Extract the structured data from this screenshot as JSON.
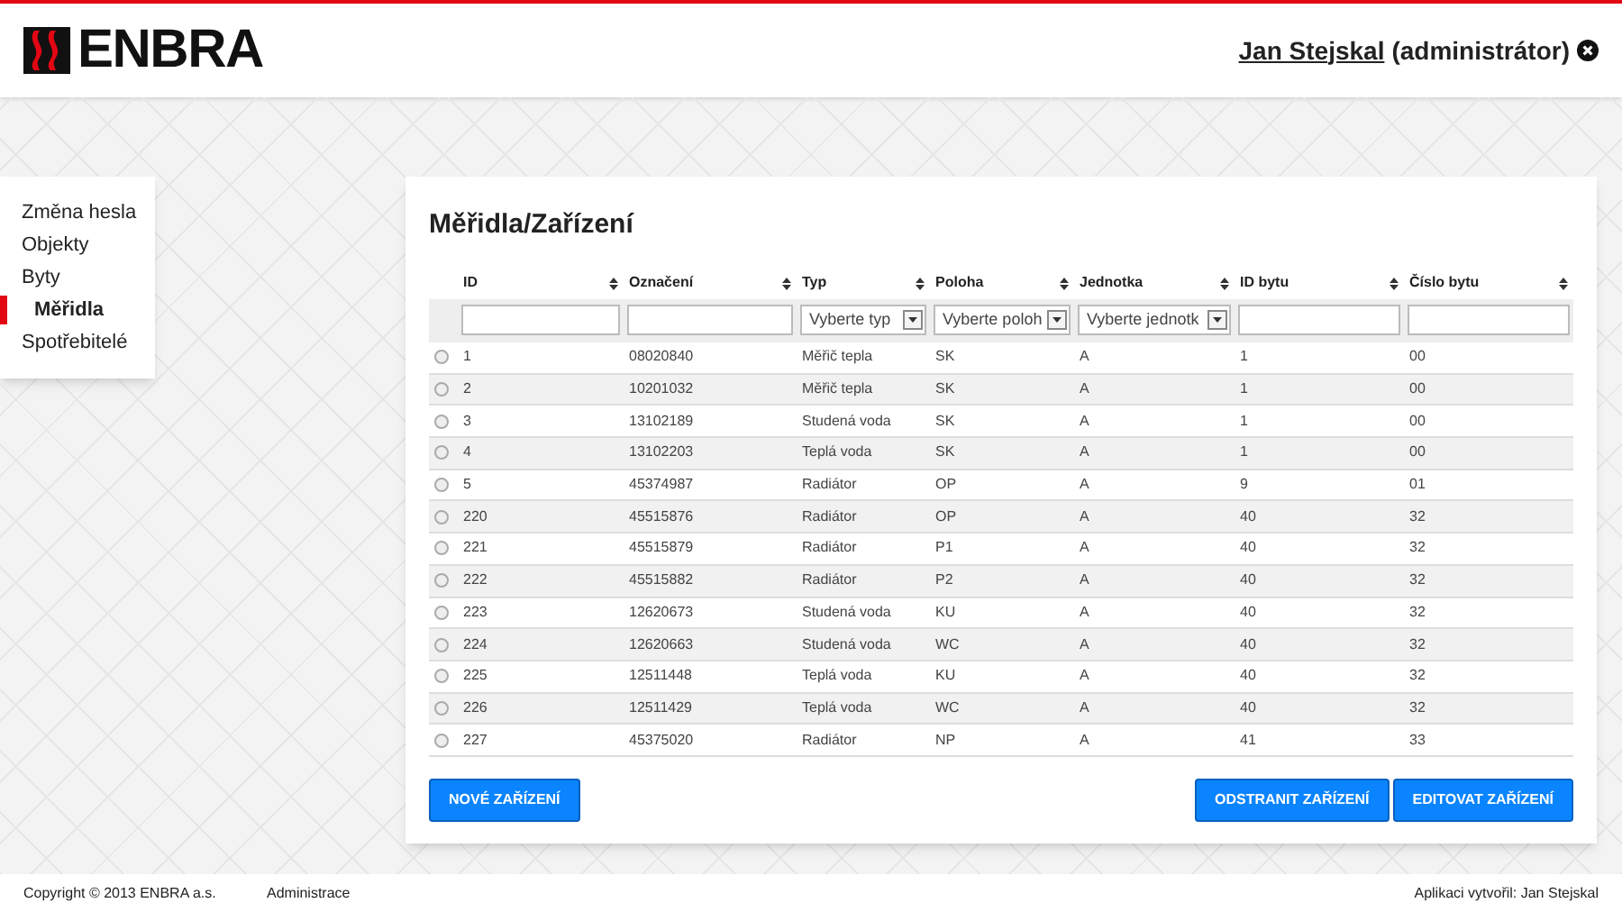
{
  "header": {
    "brand": "ENBRA",
    "user_name": "Jan Stejskal",
    "user_role": "(administrátor)"
  },
  "sidebar": {
    "items": [
      {
        "label": "Změna hesla",
        "selected": false
      },
      {
        "label": "Objekty",
        "selected": false
      },
      {
        "label": "Byty",
        "selected": false
      },
      {
        "label": "Měřidla",
        "selected": true
      },
      {
        "label": "Spotřebitelé",
        "selected": false
      }
    ]
  },
  "main": {
    "title": "Měřidla/Zařízení",
    "table": {
      "columns": [
        {
          "label": "ID",
          "filter": {
            "kind": "text"
          }
        },
        {
          "label": "Označení",
          "filter": {
            "kind": "text"
          }
        },
        {
          "label": "Typ",
          "filter": {
            "kind": "select",
            "value": "Vyberte typ"
          }
        },
        {
          "label": "Poloha",
          "filter": {
            "kind": "select",
            "value": "Vyberte poloh"
          }
        },
        {
          "label": "Jednotka",
          "filter": {
            "kind": "select",
            "value": "Vyberte jednotk"
          }
        },
        {
          "label": "ID bytu",
          "filter": {
            "kind": "text"
          }
        },
        {
          "label": "Číslo bytu",
          "filter": {
            "kind": "text"
          }
        }
      ],
      "rows": [
        {
          "selected": false,
          "cells": [
            "1",
            "08020840",
            "Měřič tepla",
            "SK",
            "A",
            "1",
            "00"
          ]
        },
        {
          "selected": false,
          "cells": [
            "2",
            "10201032",
            "Měřič tepla",
            "SK",
            "A",
            "1",
            "00"
          ]
        },
        {
          "selected": false,
          "cells": [
            "3",
            "13102189",
            "Studená voda",
            "SK",
            "A",
            "1",
            "00"
          ]
        },
        {
          "selected": false,
          "cells": [
            "4",
            "13102203",
            "Teplá voda",
            "SK",
            "A",
            "1",
            "00"
          ]
        },
        {
          "selected": false,
          "cells": [
            "5",
            "45374987",
            "Radiátor",
            "OP",
            "A",
            "9",
            "01"
          ]
        },
        {
          "selected": false,
          "cells": [
            "220",
            "45515876",
            "Radiátor",
            "OP",
            "A",
            "40",
            "32"
          ]
        },
        {
          "selected": false,
          "cells": [
            "221",
            "45515879",
            "Radiátor",
            "P1",
            "A",
            "40",
            "32"
          ]
        },
        {
          "selected": false,
          "cells": [
            "222",
            "45515882",
            "Radiátor",
            "P2",
            "A",
            "40",
            "32"
          ]
        },
        {
          "selected": false,
          "cells": [
            "223",
            "12620673",
            "Studená voda",
            "KU",
            "A",
            "40",
            "32"
          ]
        },
        {
          "selected": false,
          "cells": [
            "224",
            "12620663",
            "Studená voda",
            "WC",
            "A",
            "40",
            "32"
          ]
        },
        {
          "selected": false,
          "cells": [
            "225",
            "12511448",
            "Teplá voda",
            "KU",
            "A",
            "40",
            "32"
          ]
        },
        {
          "selected": false,
          "cells": [
            "226",
            "12511429",
            "Teplá voda",
            "WC",
            "A",
            "40",
            "32"
          ]
        },
        {
          "selected": false,
          "cells": [
            "227",
            "45375020",
            "Radiátor",
            "NP",
            "A",
            "41",
            "33"
          ]
        }
      ]
    },
    "buttons_left": [
      "NOVÉ ZAŘÍZENÍ"
    ],
    "buttons_right": [
      "ODSTRANIT ZAŘÍZENÍ",
      "EDITOVAT ZAŘÍZENÍ"
    ]
  },
  "footer": {
    "copyright": "Copyright © 2013 ENBRA a.s.",
    "link": "Administrace",
    "credit": "Aplikaci vytvořil: Jan Stejskal"
  }
}
